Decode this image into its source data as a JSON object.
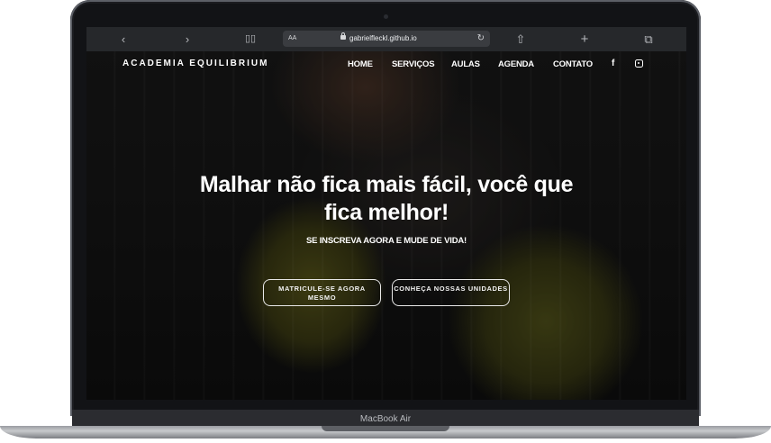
{
  "browser": {
    "text_size_label": "AA",
    "url": "gabrielfleckl.github.io",
    "icons": [
      "back-icon",
      "forward-icon",
      "reader-icon",
      "reload-icon",
      "share-icon",
      "new-tab-icon",
      "tabs-icon"
    ]
  },
  "site": {
    "brand": "ACADEMIA EQUILIBRIUM",
    "nav": [
      "HOME",
      "SERVIÇOS",
      "AULAS",
      "AGENDA",
      "CONTATO"
    ],
    "social": {
      "facebook": "f"
    },
    "hero": {
      "headline": "Malhar não fica mais fácil, você que fica melhor!",
      "subline": "SE INSCREVA AGORA E MUDE DE VIDA!",
      "cta_primary": "MATRICULE-SE AGORA MESMO",
      "cta_secondary": "CONHEÇA NOSSAS UNIDADES"
    }
  },
  "device": {
    "model": "MacBook Air"
  }
}
